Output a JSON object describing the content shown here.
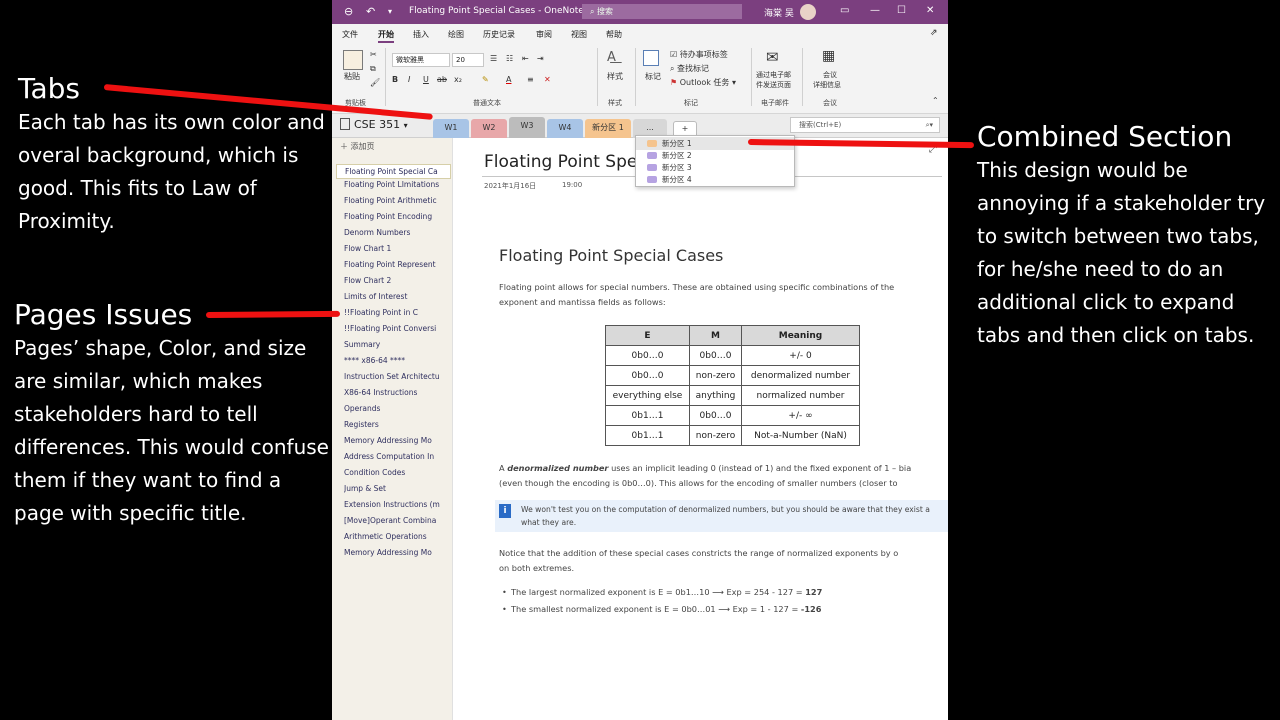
{
  "annotations": {
    "tabs": {
      "title": "Tabs",
      "body": [
        "Each tab has its own color and",
        "overal background, which is",
        "good. This fits to Law of",
        "Proximity."
      ]
    },
    "pages": {
      "title": "Pages Issues",
      "body": [
        "Pages’ shape, Color, and size",
        "are similar, which makes",
        "stakeholders hard to tell",
        "differences. This would confuse",
        "them if they want to find a",
        "page with specific title."
      ]
    },
    "combined": {
      "title": "Combined Section",
      "body": [
        "This design would be",
        "annoying if a stakeholder try",
        "to switch between two tabs,",
        "for he/she need to do an",
        "additional click to expand",
        "tabs and then click on tabs."
      ]
    },
    "line_color": "#ee1111"
  },
  "window": {
    "title": "Floating Point Special Cases  -  OneNote",
    "search_placeholder": "搜索",
    "user": "海棠 吴",
    "accent": "#7b3f7f"
  },
  "menu": [
    "文件",
    "开始",
    "插入",
    "绘图",
    "历史记录",
    "审阅",
    "视图",
    "帮助"
  ],
  "ribbon": {
    "paste": "粘贴",
    "clipboard": "剪贴板",
    "font": "微软雅黑",
    "size": "20",
    "basic_text": "普通文本",
    "styles_btn": "样式",
    "styles": "样式",
    "tag_btn": "标记",
    "todo": "待办事项标签",
    "find_tags": "查找标记",
    "outlook_tasks": "Outlook 任务",
    "tags": "标记",
    "email_btn_1": "通过电子邮",
    "email_btn_2": "件发送页面",
    "email": "电子邮件",
    "meeting_btn_1": "会议",
    "meeting_btn_2": "详细信息",
    "meeting": "会议"
  },
  "notebook": {
    "name": "CSE 351",
    "tabs": [
      {
        "label": "W1",
        "color": "#a8c4e6"
      },
      {
        "label": "W2",
        "color": "#e8a7a9"
      },
      {
        "label": "W3",
        "color": "#bcbcbc"
      },
      {
        "label": "W4",
        "color": "#a8c4e6"
      },
      {
        "label": "新分区 1",
        "color": "#f5c48e"
      },
      {
        "label": "...",
        "color": "#d7d7d7"
      },
      {
        "label": "+",
        "color": "#ffffff"
      }
    ],
    "search": "搜索(Ctrl+E)"
  },
  "dropdown": [
    {
      "label": "新分区 1",
      "color": "#f5c48e"
    },
    {
      "label": "新分区 2",
      "color": "#b6a3e2"
    },
    {
      "label": "新分区 3",
      "color": "#b6a3e2"
    },
    {
      "label": "新分区 4",
      "color": "#b6a3e2"
    }
  ],
  "pages": {
    "add_label": "添加页",
    "items": [
      "Floating Point Special Ca",
      "Floating Point LImitations",
      "Floating Point Arithmetic",
      "Floating Point Encoding",
      "Denorm Numbers",
      "Flow Chart 1",
      "Floating Point Represent",
      "Flow Chart 2",
      "Limits of Interest",
      "!!Floating Point in C",
      "!!Floating Point Conversi",
      "Summary",
      "**** x86-64 ****",
      "Instruction Set Architectu",
      "X86-64 Instructions",
      "Operands",
      "Registers",
      "Memory Addressing Mo",
      "Address Computation In",
      "Condition Codes",
      "Jump & Set",
      "Extension Instructions (m",
      "[Move]Operant Combina",
      "Arithmetic Operations",
      "Memory Addressing Mo"
    ]
  },
  "page": {
    "title": "Floating Point Spe",
    "date": "2021年1月16日",
    "time": "19:00",
    "heading": "Floating Point Special Cases",
    "intro_1": "Floating point allows for special numbers. These are obtained using specific combinations of the",
    "intro_2": "exponent and mantissa fields as follows:",
    "table": {
      "headers": [
        "E",
        "M",
        "Meaning"
      ],
      "rows": [
        [
          "0b0…0",
          "0b0…0",
          "+/- 0"
        ],
        [
          "0b0…0",
          "non-zero",
          "denormalized number"
        ],
        [
          "everything else",
          "anything",
          "normalized number"
        ],
        [
          "0b1…1",
          "0b0…0",
          "+/- ∞"
        ],
        [
          "0b1…1",
          "non-zero",
          "Not-a-Number (NaN)"
        ]
      ]
    },
    "denorm_a": "A ",
    "denorm_b": "denormalized number",
    "denorm_c": " uses an implicit leading 0 (instead of 1) and the fixed exponent of 1 – bia",
    "denorm_2": "(even though the encoding is 0b0…0). This allows for the encoding of smaller numbers (closer to",
    "note_1": "We won't test you on the computation of denormalized numbers, but you should be aware that they exist a",
    "note_2": "what they are.",
    "notice_1": "Notice that the addition of these special cases constricts the range of normalized exponents by o",
    "notice_2": "on both extremes.",
    "bullet_1": "The largest normalized exponent is E = 0b1…10 ⟶ Exp = 254 - 127 = ",
    "bullet_1_val": "127",
    "bullet_2": "The smallest normalized exponent is E = 0b0…01 ⟶ Exp = 1 - 127 = ",
    "bullet_2_val": "-126"
  }
}
